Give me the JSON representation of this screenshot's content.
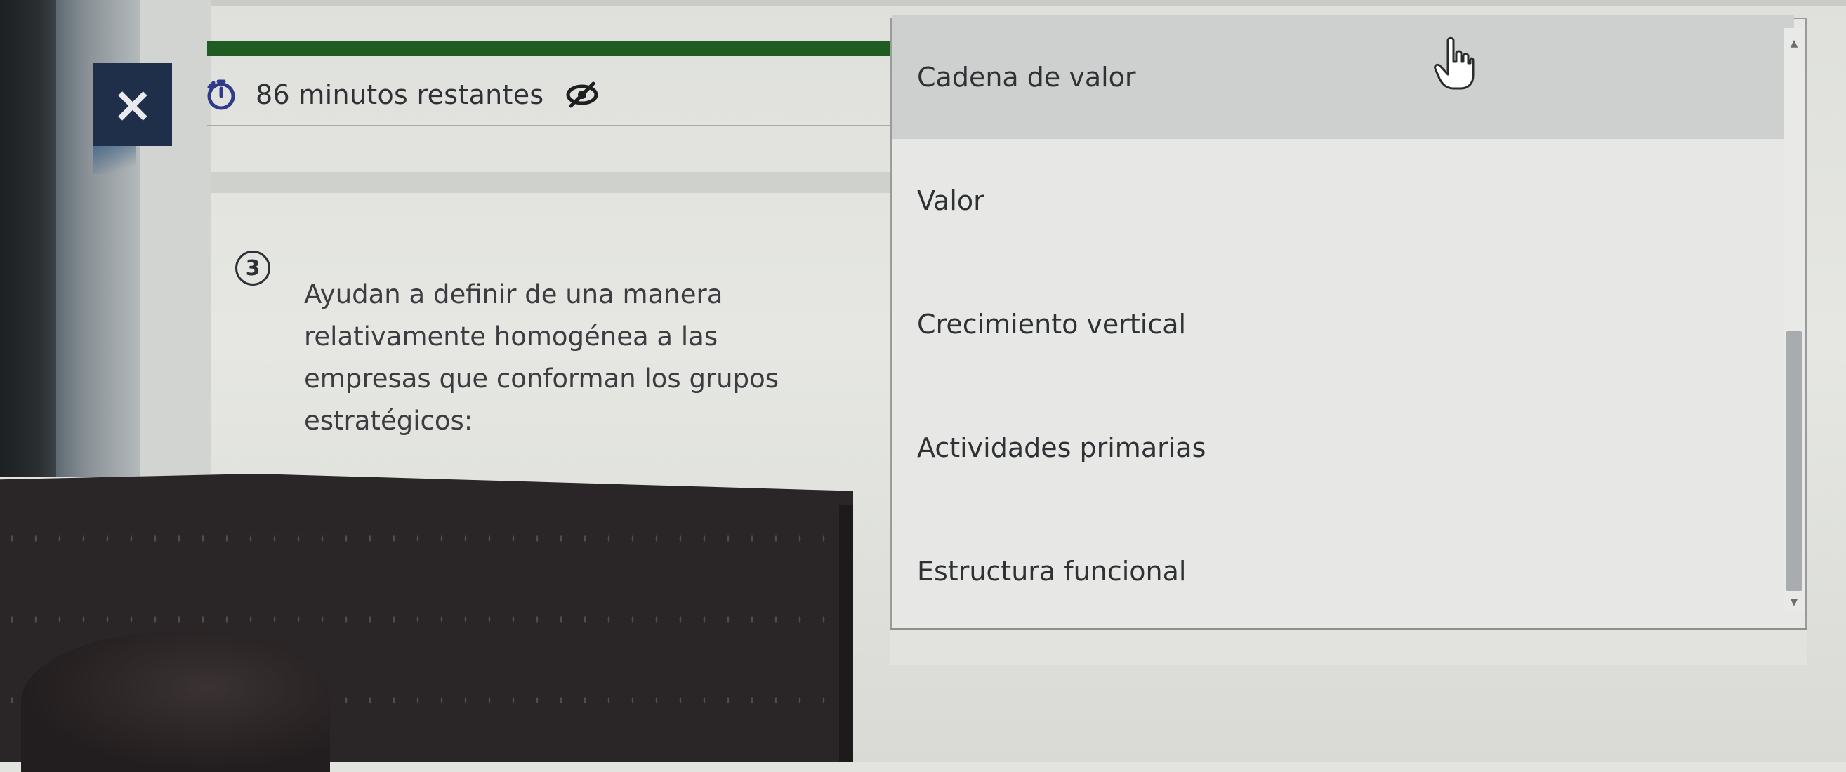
{
  "header": {
    "close_label": "×",
    "progress_fraction": 1.0,
    "timer_text": "86 minutos restantes",
    "timer_icon": "timer-icon",
    "visibility_icon": "eye-slash-icon"
  },
  "question": {
    "number": "3",
    "lines": [
      "Ayudan a definir de una manera",
      "relativamente homogénea a las",
      "empresas que conforman los grupos",
      "estratégicos:"
    ]
  },
  "dropdown": {
    "options": [
      {
        "label": "Cadena de valor",
        "selected": true
      },
      {
        "label": "Valor",
        "selected": false
      },
      {
        "label": "Crecimiento vertical",
        "selected": false
      },
      {
        "label": "Actividades primarias",
        "selected": false
      },
      {
        "label": "Estructura funcional",
        "selected": false
      }
    ]
  },
  "colors": {
    "progress": "#1f5c22",
    "close_button": "#1f2f4a",
    "selected_option": "#cdd0cf"
  }
}
